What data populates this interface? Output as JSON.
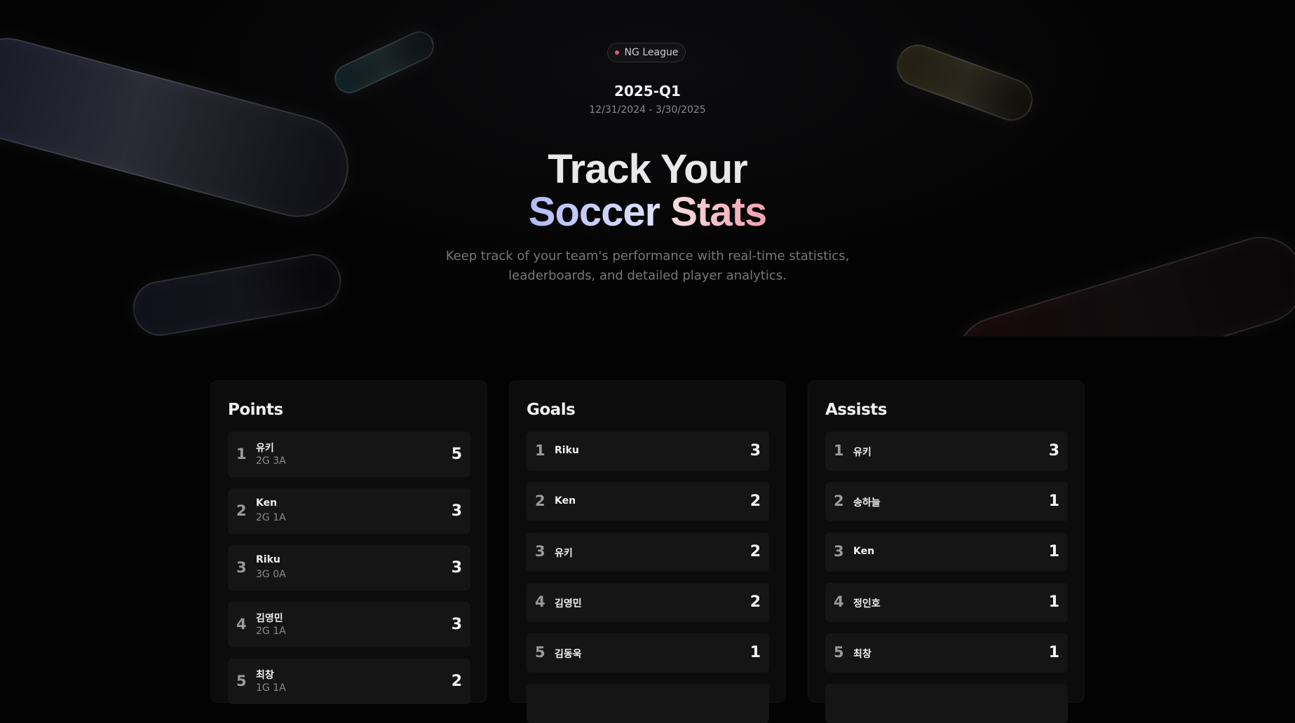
{
  "header": {
    "badge_label": "NG League",
    "badge_dot_color": "#e05a6e",
    "season": "2025-Q1",
    "date_range": "12/31/2024 - 3/30/2025"
  },
  "hero": {
    "title_line1": "Track Your",
    "title_word1": "Soccer",
    "title_word2": "Stats",
    "subtitle_line1": "Keep track of your team's performance with real-time statistics,",
    "subtitle_line2": "leaderboards, and detailed player analytics."
  },
  "boards": {
    "points": {
      "title": "Points",
      "rows": [
        {
          "rank": "1",
          "name": "유키",
          "detail": "2G 3A",
          "value": "5"
        },
        {
          "rank": "2",
          "name": "Ken",
          "detail": "2G 1A",
          "value": "3"
        },
        {
          "rank": "3",
          "name": "Riku",
          "detail": "3G 0A",
          "value": "3"
        },
        {
          "rank": "4",
          "name": "김영민",
          "detail": "2G 1A",
          "value": "3"
        },
        {
          "rank": "5",
          "name": "최창",
          "detail": "1G 1A",
          "value": "2"
        }
      ]
    },
    "goals": {
      "title": "Goals",
      "rows": [
        {
          "rank": "1",
          "name": "Riku",
          "value": "3"
        },
        {
          "rank": "2",
          "name": "Ken",
          "value": "2"
        },
        {
          "rank": "3",
          "name": "유키",
          "value": "2"
        },
        {
          "rank": "4",
          "name": "김영민",
          "value": "2"
        },
        {
          "rank": "5",
          "name": "김동욱",
          "value": "1"
        }
      ]
    },
    "assists": {
      "title": "Assists",
      "rows": [
        {
          "rank": "1",
          "name": "유키",
          "value": "3"
        },
        {
          "rank": "2",
          "name": "송하늘",
          "value": "1"
        },
        {
          "rank": "3",
          "name": "Ken",
          "value": "1"
        },
        {
          "rank": "4",
          "name": "정인호",
          "value": "1"
        },
        {
          "rank": "5",
          "name": "최창",
          "value": "1"
        }
      ]
    }
  }
}
